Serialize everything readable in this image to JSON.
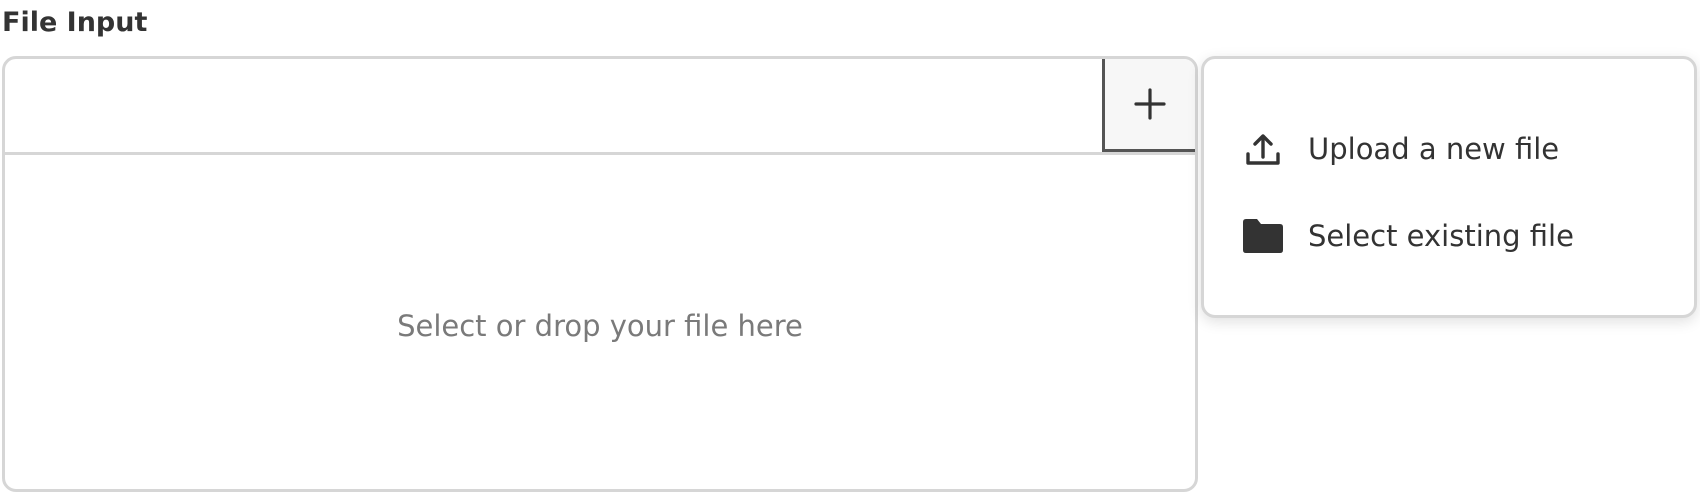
{
  "field": {
    "label": "File Input"
  },
  "dropzone": {
    "text": "Select or drop your file here"
  },
  "add_button": {
    "icon": "plus-icon"
  },
  "menu": {
    "items": [
      {
        "label": "Upload a new file",
        "icon": "upload-icon"
      },
      {
        "label": "Select existing file",
        "icon": "folder-icon"
      }
    ]
  },
  "colors": {
    "text": "#333333",
    "placeholder": "#7a7a7a",
    "border": "#d6d6d6",
    "focus_border": "#555555"
  }
}
